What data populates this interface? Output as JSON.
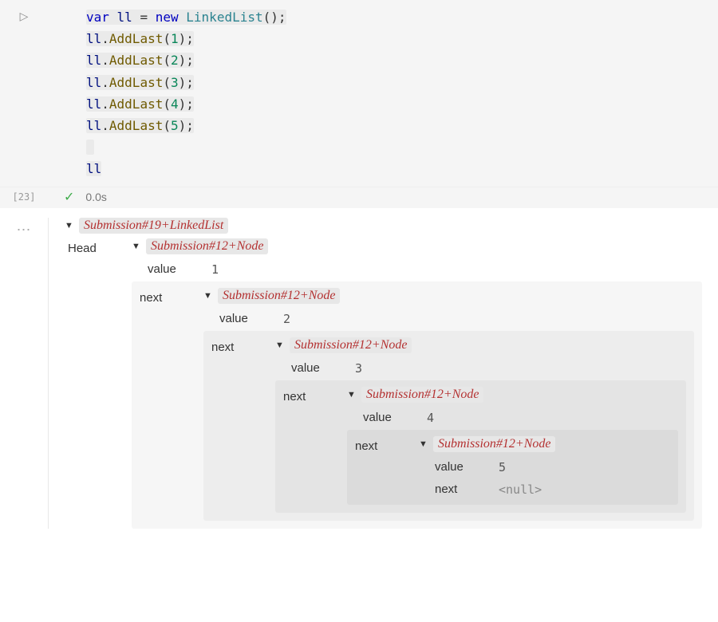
{
  "code": {
    "l1_var": "var",
    "l1_ll": "ll",
    "l1_eq": "=",
    "l1_new": "new",
    "l1_type": "LinkedList",
    "l1_parens": "();",
    "l_ll": "ll",
    "l_dot": ".",
    "l_fn": "AddLast",
    "l_open": "(",
    "l_close": ");",
    "n1": "1",
    "n2": "2",
    "n3": "3",
    "n4": "4",
    "n5": "5",
    "last_ll": "ll"
  },
  "status": {
    "cell_label": "[23]",
    "time": "0.0s"
  },
  "out": {
    "dots": "⋯",
    "root_type": "Submission#19+LinkedList",
    "head_label": "Head",
    "node_type": "Submission#12+Node",
    "value_label": "value",
    "next_label": "next",
    "v1": "1",
    "v2": "2",
    "v3": "3",
    "v4": "4",
    "v5": "5",
    "null": "<null>"
  }
}
